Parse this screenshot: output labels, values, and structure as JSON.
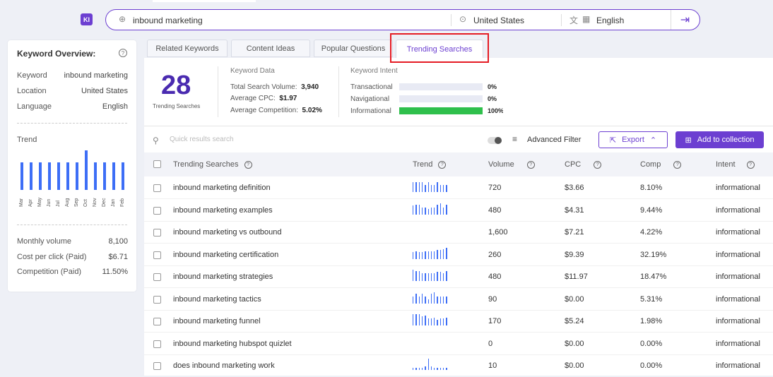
{
  "app": {
    "logo": "KI",
    "search_value": "inbound marketing",
    "location": "United States",
    "language": "English"
  },
  "overview": {
    "title": "Keyword Overview:",
    "keyword_label": "Keyword",
    "keyword_value": "inbound marketing",
    "location_label": "Location",
    "location_value": "United States",
    "language_label": "Language",
    "language_value": "English",
    "trend_label": "Trend",
    "trend_values": [
      0.7,
      0.7,
      0.7,
      0.7,
      0.7,
      0.7,
      0.7,
      1.0,
      0.7,
      0.7,
      0.7,
      0.7
    ],
    "trend_months": [
      "Mar",
      "Apr",
      "May",
      "Jun",
      "Jul",
      "Aug",
      "Sep",
      "Oct",
      "Nov",
      "Dec",
      "Jan",
      "Feb"
    ],
    "monthly_volume_label": "Monthly volume",
    "monthly_volume": "8,100",
    "cpc_label": "Cost per click (Paid)",
    "cpc": "$6.71",
    "competition_label": "Competition (Paid)",
    "competition": "11.50%"
  },
  "tabs": [
    {
      "label": "Related Keywords"
    },
    {
      "label": "Content Ideas"
    },
    {
      "label": "Popular Questions"
    },
    {
      "label": "Trending Searches"
    }
  ],
  "summary": {
    "count": "28",
    "count_label": "Trending Searches",
    "data_title": "Keyword Data",
    "total_volume_label": "Total Search Volume:",
    "total_volume": "3,940",
    "avg_cpc_label": "Average CPC:",
    "avg_cpc": "$1.97",
    "avg_comp_label": "Average Competition:",
    "avg_comp": "5.02%",
    "intent_title": "Keyword Intent",
    "intents": [
      {
        "label": "Transactional",
        "pct": "0%",
        "fraction": 0
      },
      {
        "label": "Navigational",
        "pct": "0%",
        "fraction": 0
      },
      {
        "label": "Informational",
        "pct": "100%",
        "fraction": 1
      }
    ]
  },
  "toolbar": {
    "search_placeholder": "Quick results search",
    "advanced_filter": "Advanced Filter",
    "export": "Export",
    "add_to_collection": "Add to collection"
  },
  "table": {
    "headers": [
      "Trending Searches",
      "Trend",
      "Volume",
      "CPC",
      "Comp",
      "Intent"
    ],
    "rows": [
      {
        "keyword": "inbound marketing definition",
        "volume": "720",
        "cpc": "$3.66",
        "comp": "8.10%",
        "intent": "informational",
        "trend": [
          0.9,
          0.9,
          0.9,
          0.9,
          0.6,
          0.9,
          0.6,
          0.6,
          0.9,
          0.6,
          0.6,
          0.6
        ]
      },
      {
        "keyword": "inbound marketing examples",
        "volume": "480",
        "cpc": "$4.31",
        "comp": "9.44%",
        "intent": "informational",
        "trend": [
          0.8,
          0.9,
          0.9,
          0.6,
          0.6,
          0.5,
          0.6,
          0.6,
          0.9,
          1.0,
          0.6,
          0.9
        ]
      },
      {
        "keyword": "inbound marketing vs outbound",
        "volume": "1,600",
        "cpc": "$7.21",
        "comp": "4.22%",
        "intent": "informational",
        "trend": []
      },
      {
        "keyword": "inbound marketing certification",
        "volume": "260",
        "cpc": "$9.39",
        "comp": "32.19%",
        "intent": "informational",
        "trend": [
          0.6,
          0.7,
          0.6,
          0.6,
          0.7,
          0.7,
          0.7,
          0.7,
          0.8,
          0.8,
          0.9,
          1.0
        ]
      },
      {
        "keyword": "inbound marketing strategies",
        "volume": "480",
        "cpc": "$11.97",
        "comp": "18.47%",
        "intent": "informational",
        "trend": [
          1.0,
          0.9,
          0.9,
          0.7,
          0.7,
          0.7,
          0.7,
          0.7,
          0.8,
          0.8,
          0.7,
          0.9
        ]
      },
      {
        "keyword": "inbound marketing tactics",
        "volume": "90",
        "cpc": "$0.00",
        "comp": "5.31%",
        "intent": "informational",
        "trend": [
          0.6,
          0.9,
          0.6,
          0.9,
          0.6,
          0.4,
          0.9,
          1.0,
          0.6,
          0.6,
          0.6,
          0.6
        ]
      },
      {
        "keyword": "inbound marketing funnel",
        "volume": "170",
        "cpc": "$5.24",
        "comp": "1.98%",
        "intent": "informational",
        "trend": [
          1.0,
          1.0,
          1.0,
          0.8,
          0.9,
          0.6,
          0.6,
          0.7,
          0.5,
          0.6,
          0.6,
          0.7
        ]
      },
      {
        "keyword": "inbound marketing hubspot quizlet",
        "volume": "0",
        "cpc": "$0.00",
        "comp": "0.00%",
        "intent": "informational",
        "trend": []
      },
      {
        "keyword": "does inbound marketing work",
        "volume": "10",
        "cpc": "$0.00",
        "comp": "0.00%",
        "intent": "informational",
        "trend": [
          0.2,
          0.2,
          0.2,
          0.2,
          0.3,
          1.0,
          0.3,
          0.2,
          0.2,
          0.2,
          0.2,
          0.2
        ]
      }
    ]
  }
}
